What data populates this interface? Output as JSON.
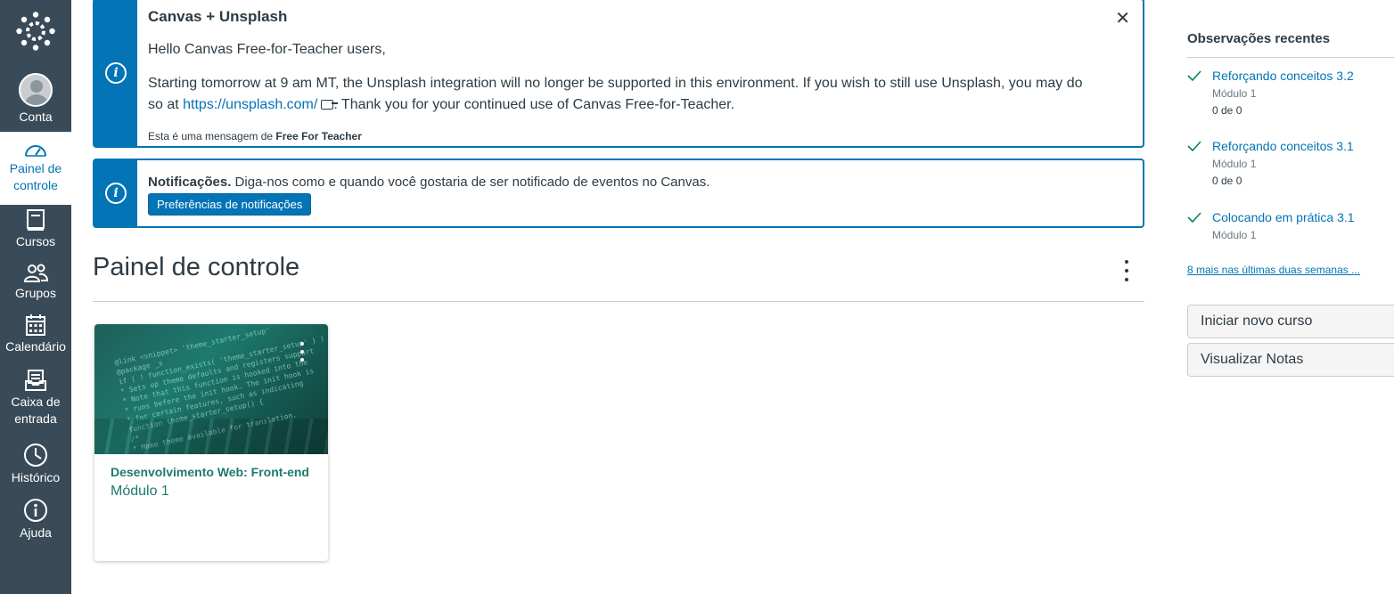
{
  "nav": {
    "account": "Conta",
    "dashboard": "Painel de controle",
    "courses": "Cursos",
    "groups": "Grupos",
    "calendar": "Calendário",
    "inbox": "Caixa de entrada",
    "history": "Histórico",
    "help": "Ajuda"
  },
  "announcement": {
    "title": "Canvas + Unsplash",
    "greeting": "Hello Canvas Free-for-Teacher users,",
    "body_start": "Starting tomorrow at 9 am MT, the Unsplash integration will no longer be supported in this environment. If you wish to still use Unsplash, you may do so at ",
    "link": "https://unsplash.com/",
    "body_end": ". Thank you for your continued use of Canvas Free-for-Teacher.",
    "message_prefix": "Esta é uma mensagem de",
    "message_from": "Free For Teacher"
  },
  "notifications": {
    "label": "Notificações.",
    "text": "Diga-nos como e quando você gostaria de ser notificado de eventos no Canvas.",
    "button": "Preferências de notificações"
  },
  "page_title": "Painel de controle",
  "course_card": {
    "title": "Desenvolvimento Web: Front-end",
    "subtitle": "Módulo 1"
  },
  "sidebar": {
    "heading": "Observações recentes",
    "items": [
      {
        "title": "Reforçando conceitos 3.2",
        "module": "Módulo 1",
        "count": "0 de 0"
      },
      {
        "title": "Reforçando conceitos 3.1",
        "module": "Módulo 1",
        "count": "0 de 0"
      },
      {
        "title": "Colocando em prática 3.1",
        "module": "Módulo 1"
      }
    ],
    "more_link": "8 mais nas últimas duas semanas ...",
    "start_course": "Iniciar novo curso",
    "view_grades": "Visualizar Notas"
  },
  "colors": {
    "nav_bg": "#394b58",
    "brand_blue": "#0374b5",
    "success_green": "#0b874b",
    "course_color": "#1d7a6e"
  }
}
